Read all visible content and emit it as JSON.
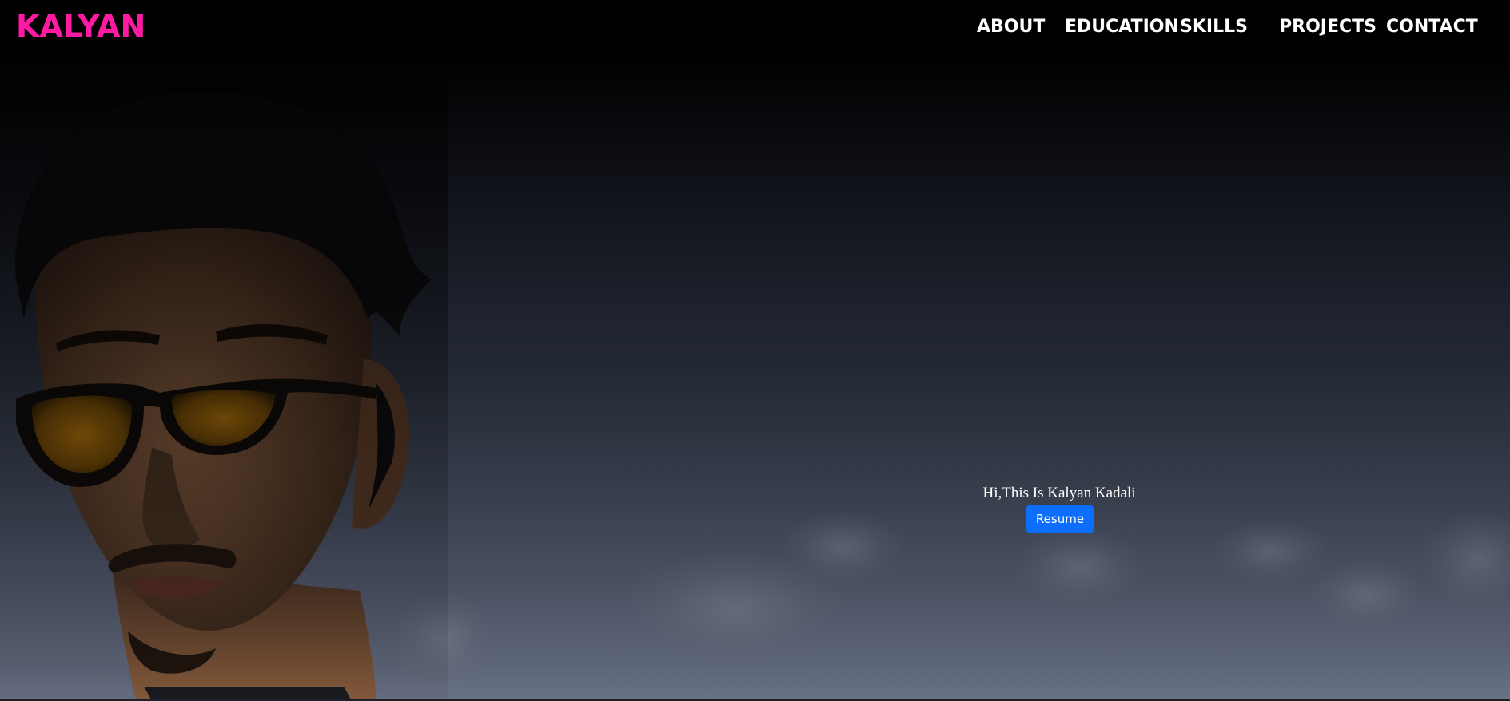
{
  "navbar": {
    "brand": "KALYAN",
    "brand_color": "#ff1aa3",
    "links": [
      {
        "label": "ABOUT"
      },
      {
        "label": "EDUCATION"
      },
      {
        "label": "SKILLS"
      },
      {
        "label": "PROJECTS"
      },
      {
        "label": "CONTACT"
      }
    ]
  },
  "hero": {
    "greeting": "Hi,This Is Kalyan Kadali",
    "resume_button": "Resume",
    "button_color": "#0d6efd"
  }
}
